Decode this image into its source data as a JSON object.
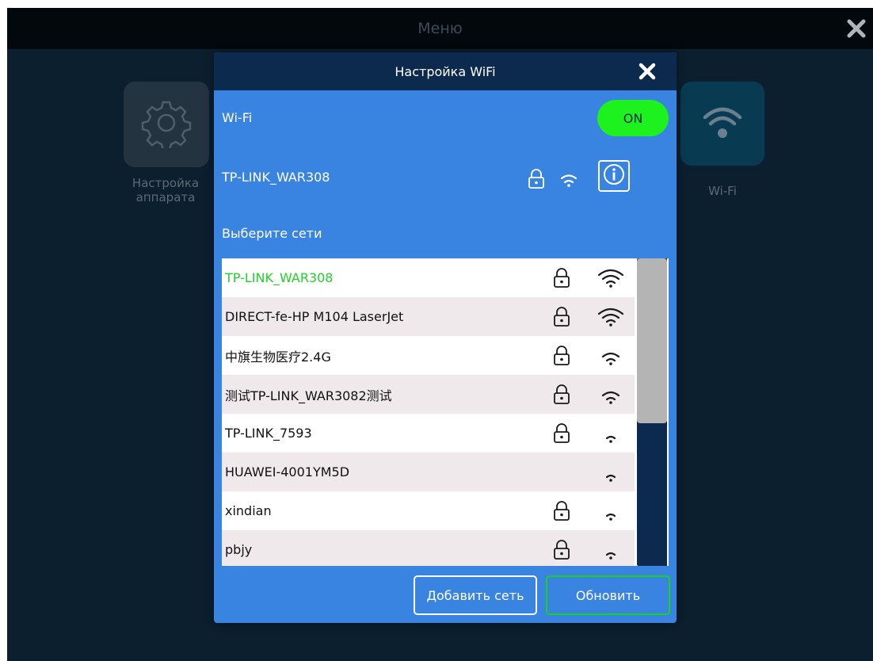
{
  "background": {
    "menu_title": "Меню",
    "tiles": [
      {
        "label_line1": "Настройка",
        "label_line2": "аппарата",
        "icon": "gear-icon"
      },
      {
        "label_line1": "Wi-Fi",
        "label_line2": "",
        "icon": "wifi-icon"
      }
    ]
  },
  "dialog": {
    "title": "Настройка WiFi",
    "wifi_label": "Wi-Fi",
    "toggle_label": "ON",
    "current_network": "TP-LINK_WAR308",
    "choose_label": "Выберите сети",
    "networks": [
      {
        "name": "TP-LINK_WAR308",
        "locked": true,
        "signal": 4,
        "connected": true
      },
      {
        "name": "DIRECT-fe-HP M104 LaserJet",
        "locked": true,
        "signal": 4,
        "connected": false
      },
      {
        "name": "中旗生物医疗2.4G",
        "locked": true,
        "signal": 3,
        "connected": false
      },
      {
        "name": "测试TP-LINK_WAR3082测试",
        "locked": true,
        "signal": 3,
        "connected": false
      },
      {
        "name": "TP-LINK_7593",
        "locked": true,
        "signal": 2,
        "connected": false
      },
      {
        "name": "HUAWEI-4001YM5D",
        "locked": false,
        "signal": 2,
        "connected": false
      },
      {
        "name": "xindian",
        "locked": true,
        "signal": 2,
        "connected": false
      },
      {
        "name": "pbjy",
        "locked": true,
        "signal": 2,
        "connected": false
      }
    ],
    "add_button": "Добавить сеть",
    "refresh_button": "Обновить"
  },
  "colors": {
    "dialog_bg": "#3884e0",
    "header_bg": "#0c2a4e",
    "toggle_on": "#1ef21e",
    "connected_text": "#22d12a"
  }
}
